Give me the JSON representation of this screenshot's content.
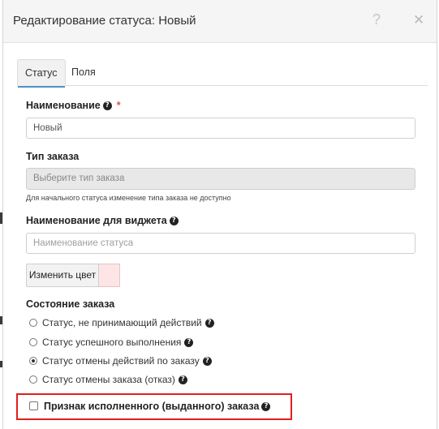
{
  "modal": {
    "title": "Редактирование статуса: Новый",
    "help_icon": "question-icon",
    "close_icon": "close-icon"
  },
  "tabs": [
    {
      "label": "Статус",
      "active": true
    },
    {
      "label": "Поля",
      "active": false
    }
  ],
  "form": {
    "name": {
      "label": "Наименование",
      "value": "Новый",
      "required_mark": "*"
    },
    "order_type": {
      "label": "Тип заказа",
      "placeholder": "Выберите тип заказа",
      "help": "Для начального статуса изменение типа заказа не доступно"
    },
    "widget_name": {
      "label": "Наименование для виджета",
      "placeholder": "Наименование статуса"
    },
    "change_color": {
      "label": "Изменить цвет",
      "color": "#fde5e6"
    },
    "order_state": {
      "label": "Состояние заказа",
      "options": [
        {
          "label": "Статус, не принимающий действий",
          "checked": false
        },
        {
          "label": "Статус успешного выполнения",
          "checked": false
        },
        {
          "label": "Статус отмены действий по заказу",
          "checked": true
        },
        {
          "label": "Статус отмены заказа (отказ)",
          "checked": false
        }
      ]
    },
    "completed_flag": {
      "label": "Признак исполненного (выданного) заказа",
      "checked": false
    }
  },
  "colors": {
    "accent": "#4d8fcb",
    "highlight": "#e01e1e",
    "required": "#d9534f"
  }
}
